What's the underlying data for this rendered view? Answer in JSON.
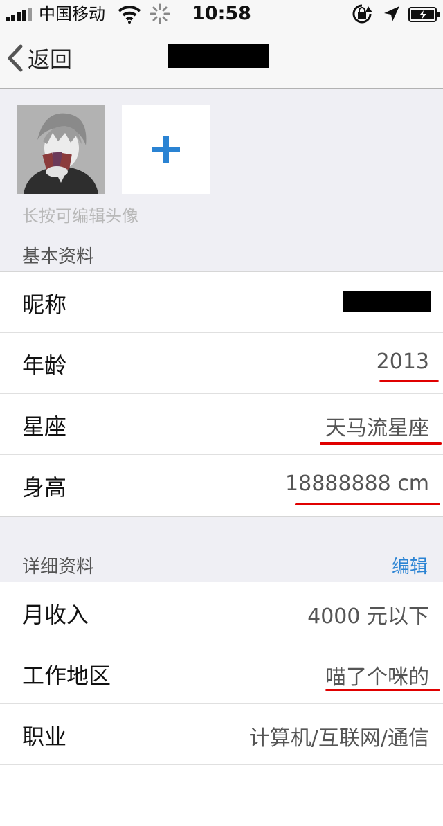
{
  "status_bar": {
    "carrier": "中国移动",
    "time": "10:58"
  },
  "nav": {
    "back_label": "返回"
  },
  "photos": {
    "hint": "长按可编辑头像"
  },
  "basic": {
    "header": "基本资料",
    "rows": [
      {
        "label": "昵称",
        "value": ""
      },
      {
        "label": "年龄",
        "value": "2013"
      },
      {
        "label": "星座",
        "value": "天马流星座"
      },
      {
        "label": "身高",
        "value": "18888888 cm"
      }
    ]
  },
  "detail": {
    "header": "详细资料",
    "edit_label": "编辑",
    "rows": [
      {
        "label": "月收入",
        "value": "4000 元以下"
      },
      {
        "label": "工作地区",
        "value": "喵了个咪的"
      },
      {
        "label": "职业",
        "value": "计算机/互联网/通信"
      }
    ]
  },
  "colors": {
    "accent": "#2a83d3",
    "annotation": "#e00000"
  }
}
